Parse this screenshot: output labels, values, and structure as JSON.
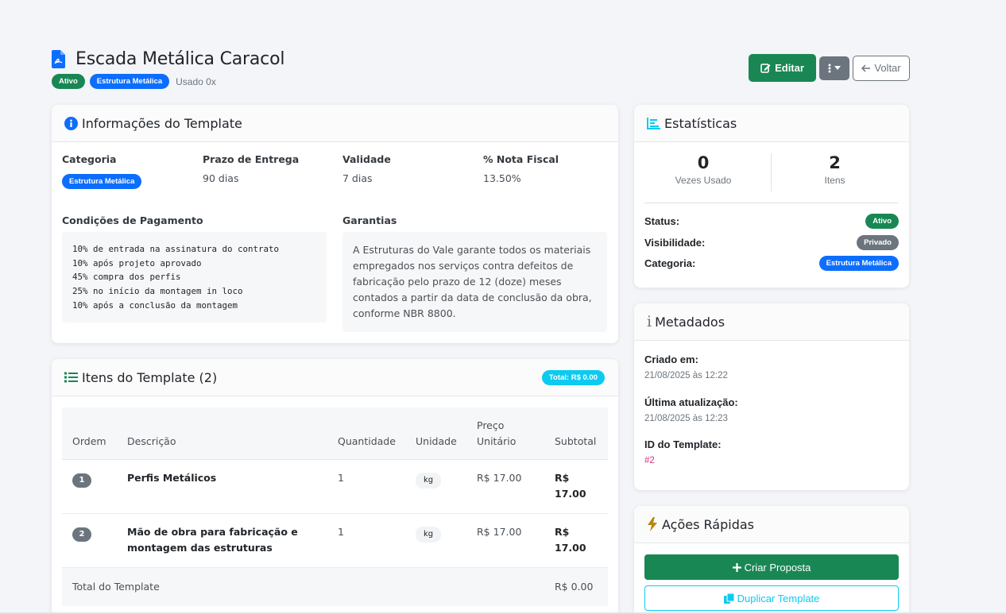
{
  "header": {
    "title": "Escada Metálica Caracol",
    "status_badge": "Ativo",
    "category_badge": "Estrutura Metálica",
    "usage": "Usado 0x",
    "edit_label": "Editar",
    "back_label": "Voltar"
  },
  "info": {
    "title": "Informações do Template",
    "category_label": "Categoria",
    "category_value": "Estrutura Metálica",
    "delivery_label": "Prazo de Entrega",
    "delivery_value": "90 dias",
    "validity_label": "Validade",
    "validity_value": "7 dias",
    "tax_label": "% Nota Fiscal",
    "tax_value": "13.50%",
    "payment_label": "Condições de Pagamento",
    "payment_lines": [
      "10% de entrada na assinatura do contrato",
      "10% após projeto aprovado",
      "45% compra dos perfis",
      "25% no início da montagem in loco",
      "10% após a conclusão da montagem"
    ],
    "warranty_label": "Garantias",
    "warranty_text": "A Estruturas do Vale garante todos os materiais empregados nos serviços contra defeitos de fabricação pelo prazo de 12 (doze) meses contados a partir da data de conclusão da obra, conforme NBR 8800."
  },
  "items": {
    "title": "Itens do Template (2)",
    "total_badge": "Total: R$ 0.00",
    "columns": {
      "order": "Ordem",
      "description": "Descrição",
      "quantity": "Quantidade",
      "unit": "Unidade",
      "price_line1": "Preço",
      "price_line2": "Unitário",
      "subtotal": "Subtotal"
    },
    "rows": [
      {
        "order": "1",
        "description_line1": "Perfis Metálicos",
        "description_line2": "",
        "quantity": "1",
        "unit": "kg",
        "price": "R$ 17.00",
        "subtotal_line1": "R$",
        "subtotal_line2": "17.00"
      },
      {
        "order": "2",
        "description_line1": "Mão de obra para fabricação e",
        "description_line2": "montagem das estruturas",
        "quantity": "1",
        "unit": "kg",
        "price": "R$ 17.00",
        "subtotal_line1": "R$",
        "subtotal_line2": "17.00"
      }
    ],
    "footer_label": "Total do Template",
    "footer_value": "R$ 0.00"
  },
  "stats": {
    "title": "Estatísticas",
    "used_count": "0",
    "used_label": "Vezes Usado",
    "items_count": "2",
    "items_label": "Itens",
    "status_label": "Status:",
    "status_value": "Ativo",
    "visibility_label": "Visibilidade:",
    "visibility_value": "Privado",
    "category_label": "Categoria:",
    "category_value": "Estrutura Metálica"
  },
  "meta": {
    "title": "Metadados",
    "created_label": "Criado em:",
    "created_value": "21/08/2025 às 12:22",
    "updated_label": "Última atualização:",
    "updated_value": "21/08/2025 às 12:23",
    "id_label": "ID do Template:",
    "id_value": "#2"
  },
  "quick": {
    "title": "Ações Rápidas",
    "create_label": "Criar Proposta",
    "duplicate_label": "Duplicar Template"
  },
  "colors": {
    "success": "#198754",
    "primary": "#0d6efd",
    "secondary": "#6c757d",
    "info": "#0dcaf0",
    "id_pink": "#d63384"
  },
  "icons": [
    "pdf-file-icon",
    "edit-icon",
    "vertical-dots-icon",
    "caret-down-icon",
    "arrow-left-icon",
    "info-circle-icon",
    "list-icon",
    "bar-chart-icon",
    "info-icon",
    "lightning-icon",
    "plus-icon",
    "copy-icon"
  ]
}
